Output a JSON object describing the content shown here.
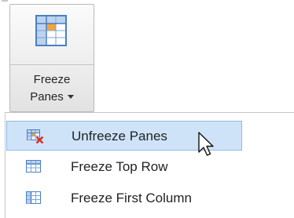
{
  "ribbon_button": {
    "label_line1": "Freeze",
    "label_line2": "Panes",
    "icon": "freeze-panes-icon",
    "has_dropdown": true
  },
  "menu": {
    "items": [
      {
        "label": "Unfreeze Panes",
        "icon": "unfreeze-panes-icon",
        "highlighted": true
      },
      {
        "label": "Freeze Top Row",
        "icon": "freeze-top-row-icon",
        "highlighted": false
      },
      {
        "label": "Freeze First Column",
        "icon": "freeze-first-column-icon",
        "highlighted": false
      }
    ]
  },
  "colors": {
    "highlight_bg": "#cfe3f8",
    "highlight_border": "#8fb9e6",
    "grid_blue": "#4a7fc1",
    "icon_orange": "#f2a43a",
    "remove_red": "#d9342b"
  }
}
